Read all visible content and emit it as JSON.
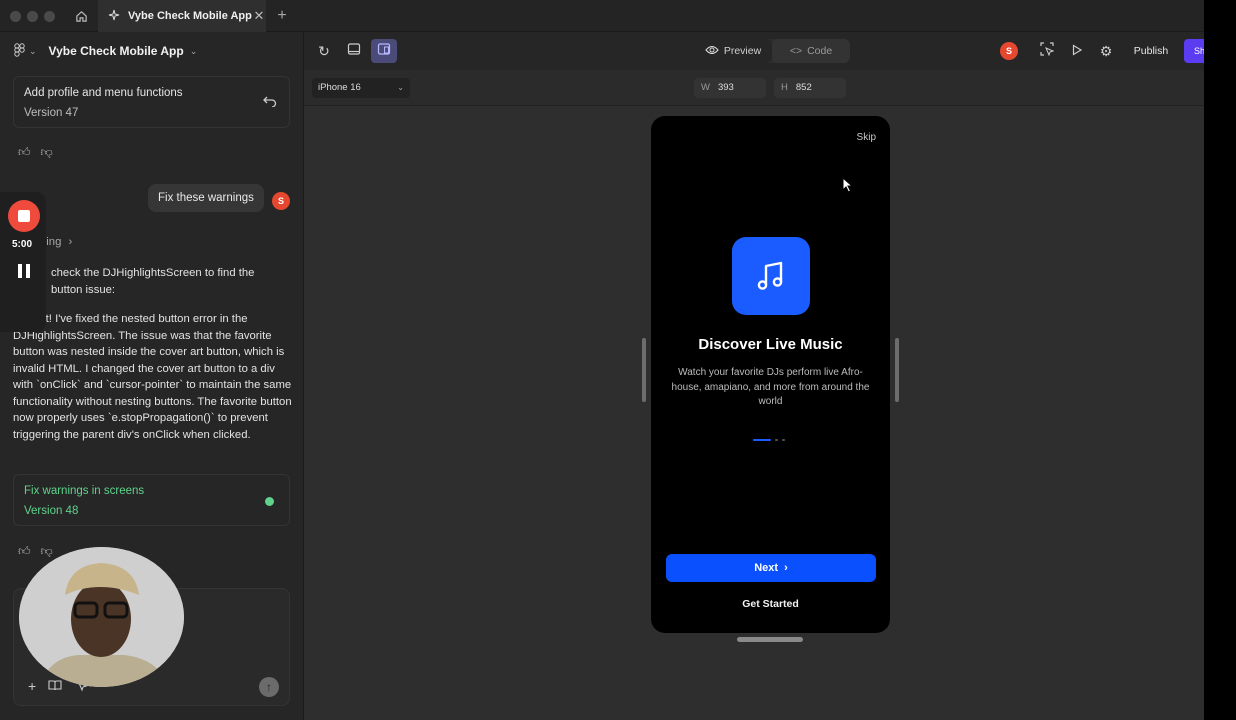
{
  "tab": {
    "title": "Vybe Check Mobile App"
  },
  "project": {
    "name": "Vybe Check Mobile App"
  },
  "history": [
    {
      "title": "Add profile and menu functions",
      "version": "Version 47"
    },
    {
      "title": "Fix warnings in screens",
      "version": "Version 48"
    }
  ],
  "user": {
    "initial": "S"
  },
  "chat": {
    "user_message": "Fix these warnings",
    "thinking_label": "hing",
    "partial_line1": "check the DJHighlightsScreen to find the",
    "partial_line2": "button issue:",
    "response": "Perfect! I've fixed the nested button error in the DJHighlightsScreen. The issue was that the favorite button was nested inside the cover art button, which is invalid HTML. I changed the cover art button to a div with `onClick` and `cursor-pointer` to maintain the same functionality without nesting buttons. The favorite button now properly uses `e.stopPropagation()` to prevent triggering the parent div's onClick when clicked."
  },
  "recorder": {
    "time": "5:00"
  },
  "toolbar": {
    "preview_label": "Preview",
    "code_label": "Code",
    "publish_label": "Publish",
    "share_label": "Sh"
  },
  "device": {
    "name": "iPhone 16",
    "width_key": "W",
    "width": "393",
    "height_key": "H",
    "height": "852"
  },
  "phone": {
    "skip": "Skip",
    "title": "Discover Live Music",
    "description": "Watch your favorite DJs perform live Afro-house, amapiano, and more from around the world",
    "next_label": "Next",
    "get_started": "Get Started"
  },
  "colors": {
    "accent": "#0a50ff",
    "brand_icon": "#1a5cff",
    "record": "#ef4b3c",
    "success": "#5fd38b",
    "share": "#5b3cf0"
  }
}
